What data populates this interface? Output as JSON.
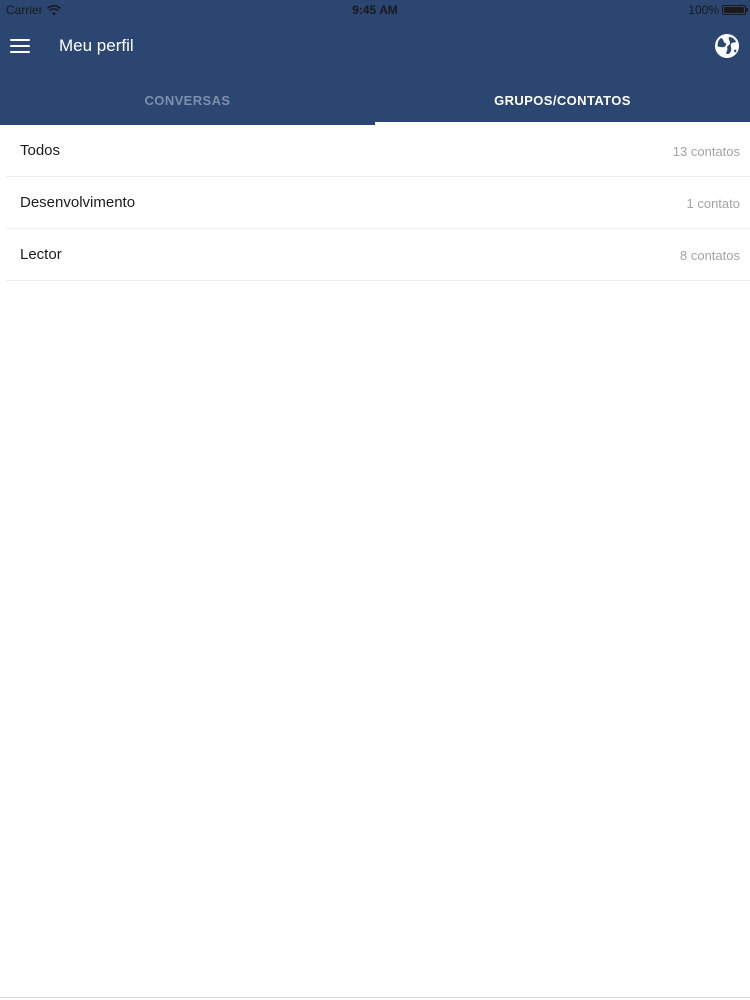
{
  "status_bar": {
    "carrier": "Carrier",
    "time": "9:45 AM",
    "battery": "100%",
    "battery_level": 1.0
  },
  "header": {
    "title": "Meu perfil",
    "menu_icon": "hamburger-menu-icon",
    "globe_icon": "globe-icon",
    "background_color": "#2b4670"
  },
  "tabs": [
    {
      "label": "CONVERSAS",
      "active": false
    },
    {
      "label": "GRUPOS/CONTATOS",
      "active": true
    }
  ],
  "groups": [
    {
      "name": "Todos",
      "count": "13 contatos"
    },
    {
      "name": "Desenvolvimento",
      "count": "1 contato"
    },
    {
      "name": "Lector",
      "count": "8 contatos"
    }
  ]
}
